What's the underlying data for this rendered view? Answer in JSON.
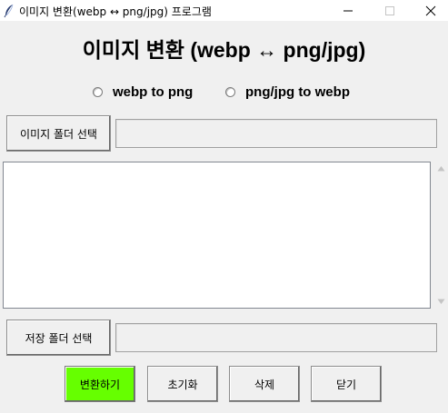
{
  "window": {
    "title": "이미지 변환(webp ↔ png/jpg) 프로그램"
  },
  "header": {
    "heading": "이미지 변환 (webp ↔ png/jpg)"
  },
  "mode_options": [
    {
      "label": "webp to png",
      "selected": false
    },
    {
      "label": "png/jpg to webp",
      "selected": false
    }
  ],
  "image_folder": {
    "button_label": "이미지 폴더 선택",
    "value": ""
  },
  "file_list": {
    "items": []
  },
  "save_folder": {
    "button_label": "저장 폴더 선택",
    "value": ""
  },
  "actions": {
    "convert_label": "변환하기",
    "reset_label": "초기화",
    "delete_label": "삭제",
    "close_label": "닫기"
  },
  "colors": {
    "convert_button": "#66ff00",
    "window_background": "#f0f0f0"
  },
  "icons": {
    "app": "feather-icon",
    "minimize": "minimize-icon",
    "maximize": "maximize-icon",
    "close": "close-icon",
    "scroll_up": "scroll-up-arrow-icon",
    "scroll_down": "scroll-down-arrow-icon"
  }
}
